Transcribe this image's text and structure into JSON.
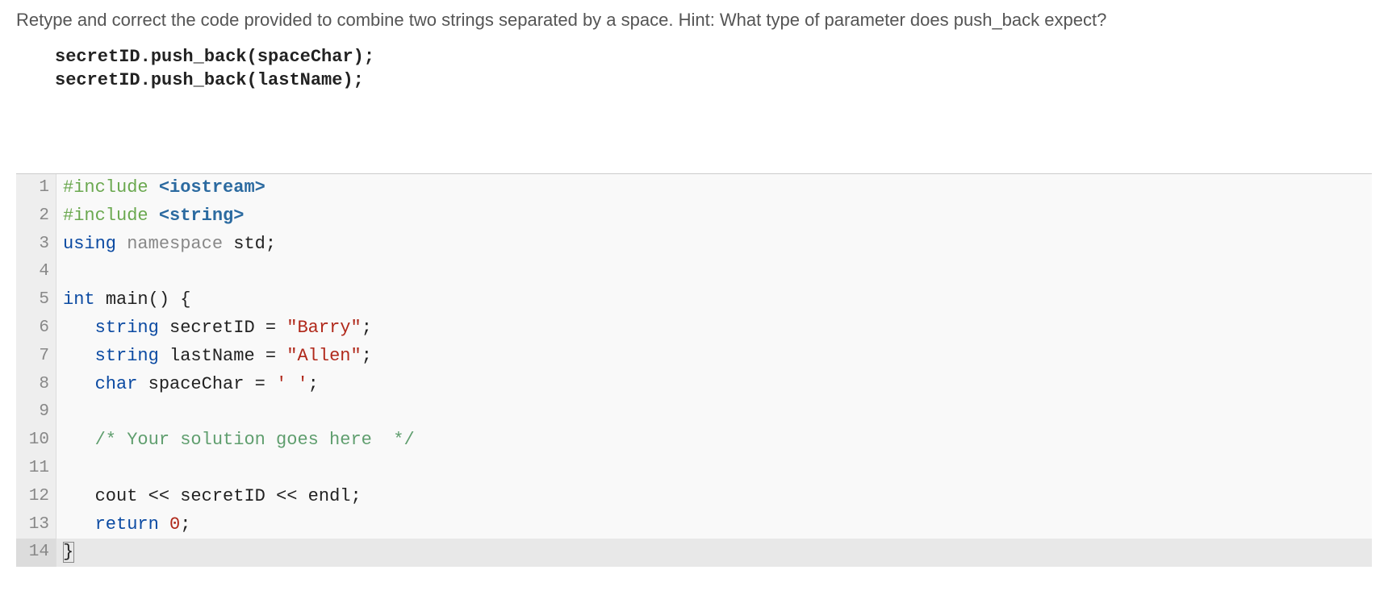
{
  "instruction": "Retype and correct the code provided to combine two strings separated by a space. Hint: What type of parameter does push_back expect?",
  "hint_code": {
    "l1": "secretID.push_back(spaceChar);",
    "l2": "secretID.push_back(lastName);"
  },
  "code": {
    "lines": [
      {
        "n": "1"
      },
      {
        "n": "2"
      },
      {
        "n": "3"
      },
      {
        "n": "4"
      },
      {
        "n": "5"
      },
      {
        "n": "6"
      },
      {
        "n": "7"
      },
      {
        "n": "8"
      },
      {
        "n": "9"
      },
      {
        "n": "10"
      },
      {
        "n": "11"
      },
      {
        "n": "12"
      },
      {
        "n": "13"
      },
      {
        "n": "14"
      }
    ],
    "tokens": {
      "include": "#include",
      "iostream": "<iostream>",
      "string_h": "<string>",
      "using": "using",
      "namespace": "namespace",
      "std": "std",
      "semi": ";",
      "int": "int",
      "main": "main",
      "lparen": "(",
      "rparen": ")",
      "lbrace": "{",
      "rbrace": "}",
      "string_t": "string",
      "secretID": "secretID",
      "eq": "=",
      "barry": "\"Barry\"",
      "lastName": "lastName",
      "allen": "\"Allen\"",
      "char_t": "char",
      "spaceChar": "spaceChar",
      "space_lit": "' '",
      "comment": "/* Your solution goes here  */",
      "cout": "cout",
      "lshift": "<<",
      "endl": "endl",
      "return": "return",
      "zero": "0"
    }
  }
}
